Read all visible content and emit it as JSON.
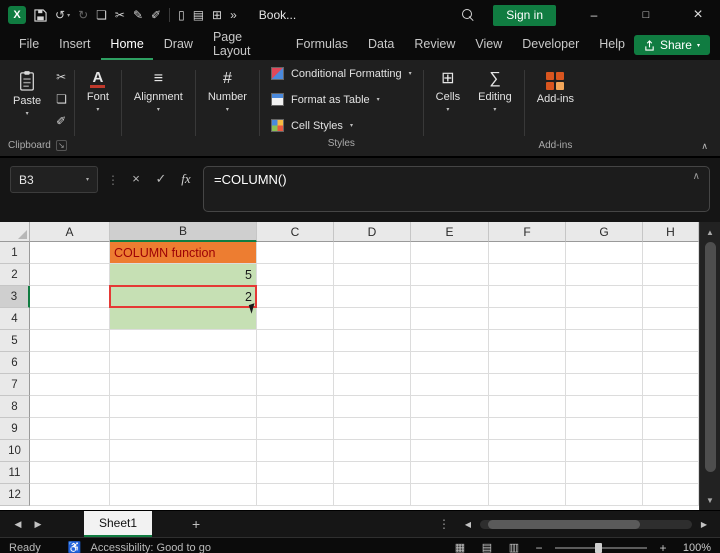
{
  "titlebar": {
    "document_title": "Book...",
    "sign_in_label": "Sign in"
  },
  "menu_bar": {
    "tabs": [
      "File",
      "Insert",
      "Home",
      "Draw",
      "Page Layout",
      "Formulas",
      "Data",
      "Review",
      "View",
      "Developer",
      "Help"
    ],
    "active_tab": "Home",
    "share_label": "Share"
  },
  "ribbon": {
    "paste_label": "Paste",
    "font_label": "Font",
    "alignment_label": "Alignment",
    "number_label": "Number",
    "conditional_formatting_label": "Conditional Formatting",
    "format_as_table_label": "Format as Table",
    "cell_styles_label": "Cell Styles",
    "cells_label": "Cells",
    "editing_label": "Editing",
    "addins_label": "Add-ins",
    "clipboard_group_label": "Clipboard",
    "styles_group_label": "Styles",
    "addins_group_label": "Add-ins"
  },
  "formula_bar": {
    "name_box_value": "B3",
    "fx_label": "fx",
    "formula": "=COLUMN()"
  },
  "grid": {
    "column_headers": [
      "A",
      "B",
      "C",
      "D",
      "E",
      "F",
      "G",
      "H"
    ],
    "row_headers": [
      "1",
      "2",
      "3",
      "4",
      "5",
      "6",
      "7",
      "8",
      "9",
      "10",
      "11",
      "12"
    ],
    "selected_column": "B",
    "selected_row": "3",
    "cells": [
      {
        "ref": "B1",
        "text": "COLUMN function",
        "bg": "#ED7D31",
        "color": "#9C0006",
        "align": "left"
      },
      {
        "ref": "B2",
        "text": "5",
        "bg": "#C6E0B4",
        "color": "#1a1a1a",
        "align": "right"
      },
      {
        "ref": "B3",
        "text": "2",
        "bg": "#C6E0B4",
        "color": "#1a1a1a",
        "align": "right",
        "annotated": true
      },
      {
        "ref": "B4",
        "text": "",
        "bg": "#C6E0B4",
        "color": "#1a1a1a",
        "align": "right"
      }
    ],
    "annotation_color": "#E53935"
  },
  "sheet_bar": {
    "active_sheet": "Sheet1"
  },
  "status_bar": {
    "mode": "Ready",
    "accessibility": "Accessibility: Good to go",
    "zoom": "100%"
  },
  "colors": {
    "accent_green": "#107C41",
    "active_tab_underline": "#2EA062",
    "cell_fill_green": "#C6E0B4",
    "cell_fill_orange": "#ED7D31"
  },
  "icons": {
    "excel_logo": "X",
    "undo": "↺",
    "redo": "↻",
    "copy": "❏",
    "cut": "✂",
    "pen": "✎",
    "highlighter": "✐",
    "document": "▯",
    "print": "▤",
    "table": "⊞",
    "overflow": "»",
    "chevron_down": "▾",
    "chevron_up": "∧",
    "ellipsis_v": "⋮",
    "cancel": "×",
    "check": "✓",
    "minimize": "–",
    "maximize": "□",
    "close": "×",
    "left": "◀",
    "right": "▶",
    "up": "▲",
    "down": "▼",
    "plus": "+",
    "minus": "−",
    "align_lines": "≡",
    "number_sign": "#",
    "cells_grid": "⊞",
    "editing_sigma": "∑",
    "dialog_launcher": "↘",
    "view_normal": "▦",
    "view_layout": "▤",
    "view_break": "▥",
    "accessibility": "♿",
    "font_a": "A"
  }
}
